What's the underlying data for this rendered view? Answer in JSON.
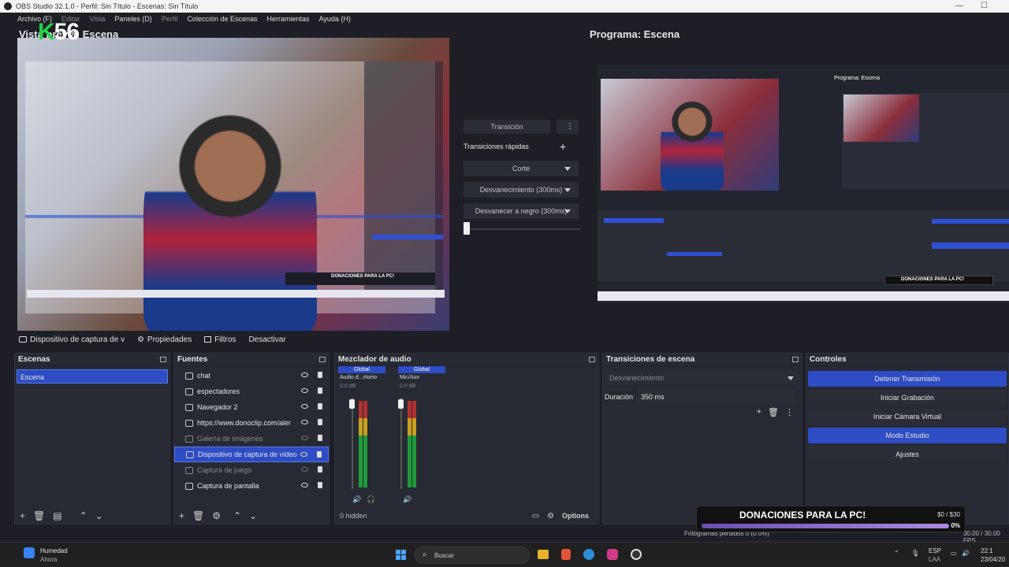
{
  "window": {
    "title": "OBS Studio 32.1.0 - Perfil: Sin Título - Escenas: Sin Título"
  },
  "menu": [
    {
      "label": "Archivo (F)",
      "dim": false
    },
    {
      "label": "Editar",
      "dim": true
    },
    {
      "label": "Vista",
      "dim": true
    },
    {
      "label": "Paneles (D)",
      "dim": false
    },
    {
      "label": "Perfil",
      "dim": true
    },
    {
      "label": "Colección de Escenas",
      "dim": false
    },
    {
      "label": "Herramientas",
      "dim": false
    },
    {
      "label": "Ayuda (H)",
      "dim": false
    }
  ],
  "preview": {
    "label": "Vista previa: Escena",
    "overlay_number": "56",
    "overlay_letter": "K"
  },
  "program": {
    "label": "Programa: Escena"
  },
  "transition_panel": {
    "transition_button": "Transición",
    "quick_transitions_label": "Transiciones rápidas",
    "options": [
      "Corte",
      "Desvanecimiento (300ms)",
      "Desvanecer a negro (300ms)"
    ]
  },
  "source_toolbar": {
    "selected_source": "Dispositivo de captura de v",
    "properties": "Propiedades",
    "filters": "Filtros",
    "deactivate": "Desactivar"
  },
  "scenes": {
    "title": "Escenas",
    "items": [
      "Escena"
    ]
  },
  "sources": {
    "title": "Fuentes",
    "items": [
      {
        "label": "chat",
        "dim": false,
        "selected": false
      },
      {
        "label": "espectadores",
        "dim": false,
        "selected": false
      },
      {
        "label": "Navegador 2",
        "dim": false,
        "selected": false
      },
      {
        "label": "https://www.donoclip.com/aler",
        "dim": false,
        "selected": false
      },
      {
        "label": "Galería de imágenes",
        "dim": true,
        "selected": false
      },
      {
        "label": "Dispositivo de captura de vídeo",
        "dim": false,
        "selected": true
      },
      {
        "label": "Captura de juego",
        "dim": true,
        "selected": false
      },
      {
        "label": "Captura de pantalla",
        "dim": false,
        "selected": false
      }
    ]
  },
  "mixer": {
    "title": "Mezclador de audio",
    "channels": [
      {
        "tag": "Global",
        "name": "Audio d...ritorio",
        "db": "0.0 dB"
      },
      {
        "tag": "Global",
        "name": "Mic/Aux",
        "db": "0.0 dB"
      }
    ],
    "hidden_label": "0 hidden",
    "options_label": "Options"
  },
  "scene_transitions": {
    "title": "Transiciones de escena",
    "selected": "Desvanecimiento",
    "duration_label": "Duración",
    "duration_value": "350 ms"
  },
  "controls": {
    "title": "Controles",
    "buttons": [
      {
        "label": "Detener Transmisión",
        "active": true
      },
      {
        "label": "Iniciar Grabación",
        "active": false
      },
      {
        "label": "Iniciar Cámara Virtual",
        "active": false
      },
      {
        "label": "Modo Estudio",
        "active": true
      },
      {
        "label": "Ajustes",
        "active": false
      }
    ]
  },
  "donation": {
    "text": "DONACIONES PARA LA PC!",
    "amount": "$0 / $30",
    "percent": "0%"
  },
  "status": {
    "frames": "Fotogramas perdidos 0 (0.0%)",
    "fps": "30.00 / 30.00 FPS"
  },
  "taskbar": {
    "weather_title": "Humedad",
    "weather_sub": "Ahora",
    "search_placeholder": "Buscar",
    "lang": "ESP",
    "lang_sub": "LAA",
    "time": "22:1",
    "date": "23/04/20"
  }
}
